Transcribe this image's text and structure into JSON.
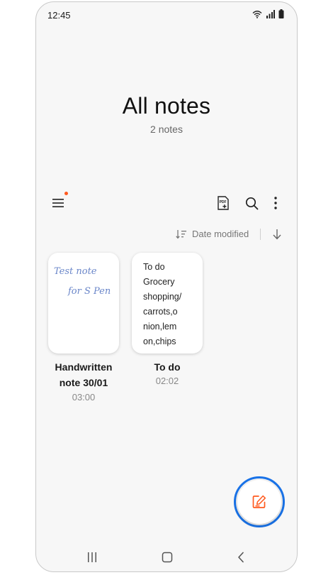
{
  "status_bar": {
    "time": "12:45",
    "icons": [
      "wifi-icon",
      "signal-icon",
      "battery-icon"
    ]
  },
  "header": {
    "title": "All notes",
    "subtitle": "2 notes"
  },
  "toolbar": {
    "icons": [
      "menu-icon",
      "pdf-add-icon",
      "search-icon",
      "more-options-icon"
    ],
    "menu_has_notification": true
  },
  "sort": {
    "label": "Date modified",
    "direction": "descending"
  },
  "notes": [
    {
      "title_line1": "Handwritten",
      "title_line2": "note 30/01",
      "time": "03:00",
      "handwriting_line1": "Test note",
      "handwriting_line2": "for S Pen"
    },
    {
      "title": "To do",
      "time": "02:02",
      "preview": "To do\nGrocery\nshopping/\ncarrots,o\nnion,lem\non,chips"
    }
  ],
  "fab": {
    "icon": "compose-note-icon"
  },
  "nav": {
    "icons": [
      "recent-apps-icon",
      "home-icon",
      "back-icon"
    ]
  },
  "colors": {
    "accent": "#ff5a1f",
    "highlight_ring": "#1a73e8",
    "handwriting": "#6a86c9"
  }
}
